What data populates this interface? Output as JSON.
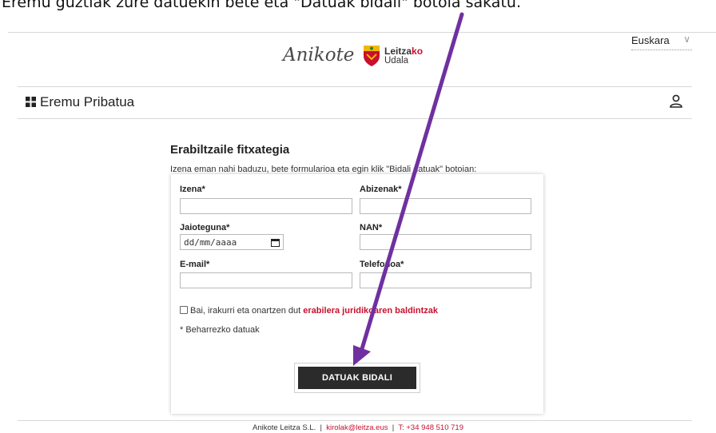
{
  "caption": "Eremu guztiak zure datuekin bete eta \"Datuak bidali\" botoia sakatu.",
  "language": {
    "selected": "Euskara"
  },
  "logos": {
    "brand_a": "Anikote",
    "brand_b_line1_a": "Leitza",
    "brand_b_line1_b": "ko",
    "brand_b_line2": "Udala"
  },
  "header": {
    "title": "Eremu Pribatua"
  },
  "form": {
    "title": "Erabiltzaile fitxategia",
    "intro": "Izena eman nahi baduzu, bete formularioa eta egin klik \"Bidali datuak\" botoian:",
    "fields": {
      "name_label": "Izena*",
      "surname_label": "Abizenak*",
      "birthdate_label": "Jaioteguna*",
      "birthdate_placeholder": "dd/mm/aaaa",
      "nan_label": "NAN*",
      "email_label": "E-mail*",
      "phone_label": "Telefonoa*"
    },
    "consent_prefix": "Bai, irakurri eta onartzen dut ",
    "consent_link": "erabilera juridikoaren baldintzak",
    "required_note": "* Beharrezko datuak",
    "submit_label": "DATUAK BIDALI"
  },
  "footer": {
    "company": "Anikote Leitza S.L.",
    "separator": "|",
    "email": "kirolak@leitza.eus",
    "phone": "T: +34 948 510 719"
  },
  "colors": {
    "accent_red": "#c8102e",
    "arrow_purple": "#7030a0",
    "button_dark": "#2b2b2b"
  }
}
